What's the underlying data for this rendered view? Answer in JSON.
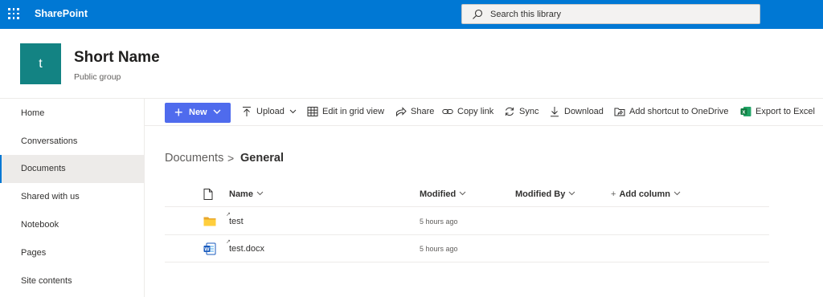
{
  "suite_bar": {
    "app_name": "SharePoint",
    "search_placeholder": "Search this library",
    "color": "#0078d4"
  },
  "site": {
    "logo_letter": "t",
    "title": "Short Name",
    "subtitle": "Public group",
    "logo_color": "#138383"
  },
  "left_nav": {
    "items": [
      {
        "label": "Home"
      },
      {
        "label": "Conversations"
      },
      {
        "label": "Documents",
        "active": true
      },
      {
        "label": "Shared with us"
      },
      {
        "label": "Notebook"
      },
      {
        "label": "Pages"
      },
      {
        "label": "Site contents"
      }
    ]
  },
  "command_bar": {
    "new_label": "New",
    "new_color": "#4f6bed",
    "upload": "Upload",
    "edit_grid": "Edit in grid view",
    "share": "Share",
    "copy_link": "Copy link",
    "sync": "Sync",
    "download": "Download",
    "add_shortcut": "Add shortcut to OneDrive",
    "export_excel": "Export to Excel"
  },
  "breadcrumb": {
    "root": "Documents",
    "separator": ">",
    "current": "General"
  },
  "list": {
    "columns": {
      "name": "Name",
      "modified": "Modified",
      "modified_by": "Modified By",
      "add_column": "Add column"
    },
    "rows": [
      {
        "name": "test",
        "type": "folder-icon",
        "modified": "5 hours ago",
        "modified_by": ""
      },
      {
        "name": "test.docx",
        "type": "word-doc-icon",
        "modified": "5 hours ago",
        "modified_by": ""
      }
    ]
  }
}
